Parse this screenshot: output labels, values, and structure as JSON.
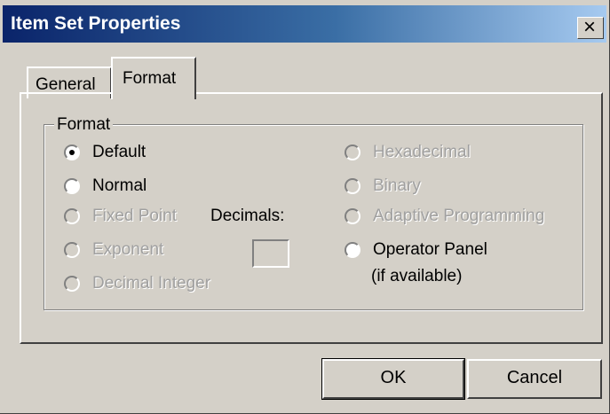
{
  "window": {
    "title": "Item Set Properties",
    "close_glyph": "×"
  },
  "tabs": [
    {
      "label": "General",
      "active": false
    },
    {
      "label": "Format",
      "active": true
    }
  ],
  "format_group": {
    "label": "Format",
    "options": [
      {
        "label": "Default",
        "selected": true,
        "enabled": true
      },
      {
        "label": "Normal",
        "selected": false,
        "enabled": true
      },
      {
        "label": "Fixed Point",
        "selected": false,
        "enabled": false
      },
      {
        "label": "Exponent",
        "selected": false,
        "enabled": false
      },
      {
        "label": "Decimal Integer",
        "selected": false,
        "enabled": false
      },
      {
        "label": "Hexadecimal",
        "selected": false,
        "enabled": false
      },
      {
        "label": "Binary",
        "selected": false,
        "enabled": false
      },
      {
        "label": "Adaptive Programming",
        "selected": false,
        "enabled": false
      },
      {
        "label": "Operator Panel",
        "sublabel": "(if available)",
        "selected": false,
        "enabled": true
      }
    ],
    "decimals": {
      "label": "Decimals:",
      "value": ""
    }
  },
  "buttons": {
    "ok": "OK",
    "cancel": "Cancel"
  }
}
